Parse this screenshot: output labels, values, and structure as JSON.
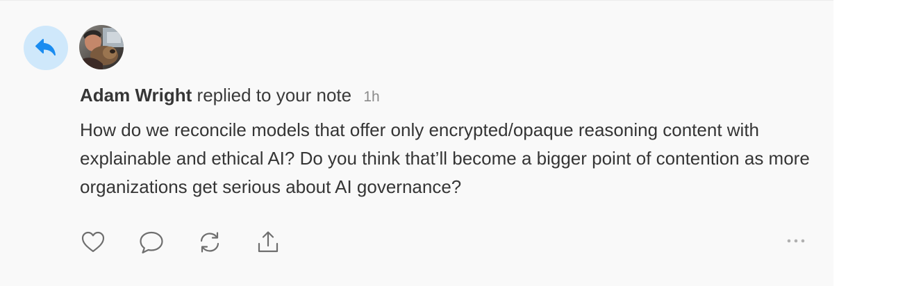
{
  "notification": {
    "type_icon": "reply-arrow-icon",
    "author": "Adam Wright",
    "action": "replied to your note",
    "time": "1h",
    "body": "How do we reconcile models that offer only encrypted/opaque reasoning content with explainable and ethical AI? Do you think that’ll become a bigger point of contention as more organizations get serious about AI governance?"
  },
  "actions": [
    {
      "icon": "heart-icon"
    },
    {
      "icon": "comment-icon"
    },
    {
      "icon": "restack-icon"
    },
    {
      "icon": "share-icon"
    }
  ],
  "more_icon": "more-horizontal-icon",
  "colors": {
    "card_background": "#f9f9f9",
    "reply_badge_bg": "#cfe8fb",
    "reply_arrow": "#1a8cf0",
    "text": "#353535",
    "muted": "#8a8a8a",
    "icon": "#6e6e6e"
  }
}
